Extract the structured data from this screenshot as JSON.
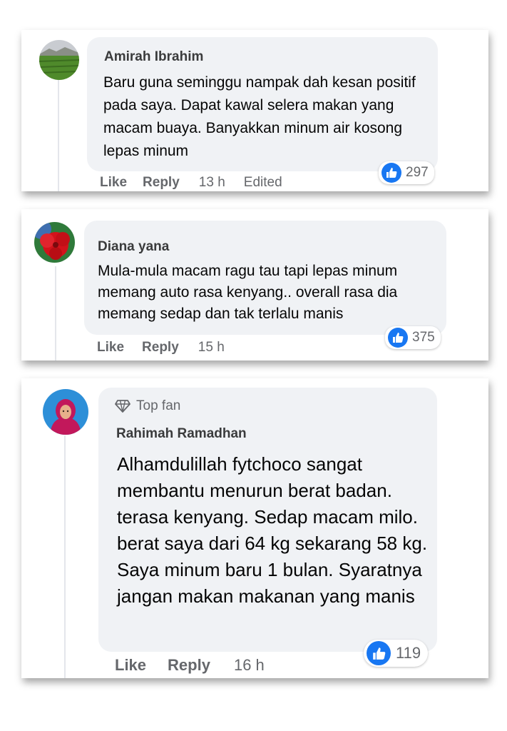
{
  "comments": [
    {
      "author": "Amirah Ibrahim",
      "text": "Baru guna seminggu nampak dah kesan positif pada saya. Dapat kawal selera makan yang macam buaya. Banyakkan minum air kosong lepas minum",
      "like_label": "Like",
      "reply_label": "Reply",
      "time": "13 h",
      "edited": "Edited",
      "reactions": "297",
      "like_icon": "thumbs-up-icon",
      "avatar": "landscape-field-avatar"
    },
    {
      "author": "Diana yana",
      "text": "Mula-mula macam ragu tau tapi lepas minum memang auto rasa kenyang.. overall rasa dia memang sedap dan tak terlalu manis",
      "like_label": "Like",
      "reply_label": "Reply",
      "time": "15 h",
      "reactions": "375",
      "like_icon": "thumbs-up-icon",
      "avatar": "red-hibiscus-avatar"
    },
    {
      "badge": "Top fan",
      "badge_icon": "diamond-icon",
      "author": "Rahimah Ramadhan",
      "text": "Alhamdulillah fytchoco sangat membantu menurun berat badan. terasa kenyang. Sedap macam milo. berat saya dari 64 kg sekarang 58 kg. Saya minum baru 1 bulan. Syaratnya jangan makan makanan yang manis",
      "like_label": "Like",
      "reply_label": "Reply",
      "time": "16 h",
      "reactions": "119",
      "like_icon": "thumbs-up-icon",
      "avatar": "hijab-woman-avatar"
    }
  ],
  "colors": {
    "bubble": "#f0f2f5",
    "like_blue": "#1877f2",
    "meta_gray": "#65676b"
  }
}
